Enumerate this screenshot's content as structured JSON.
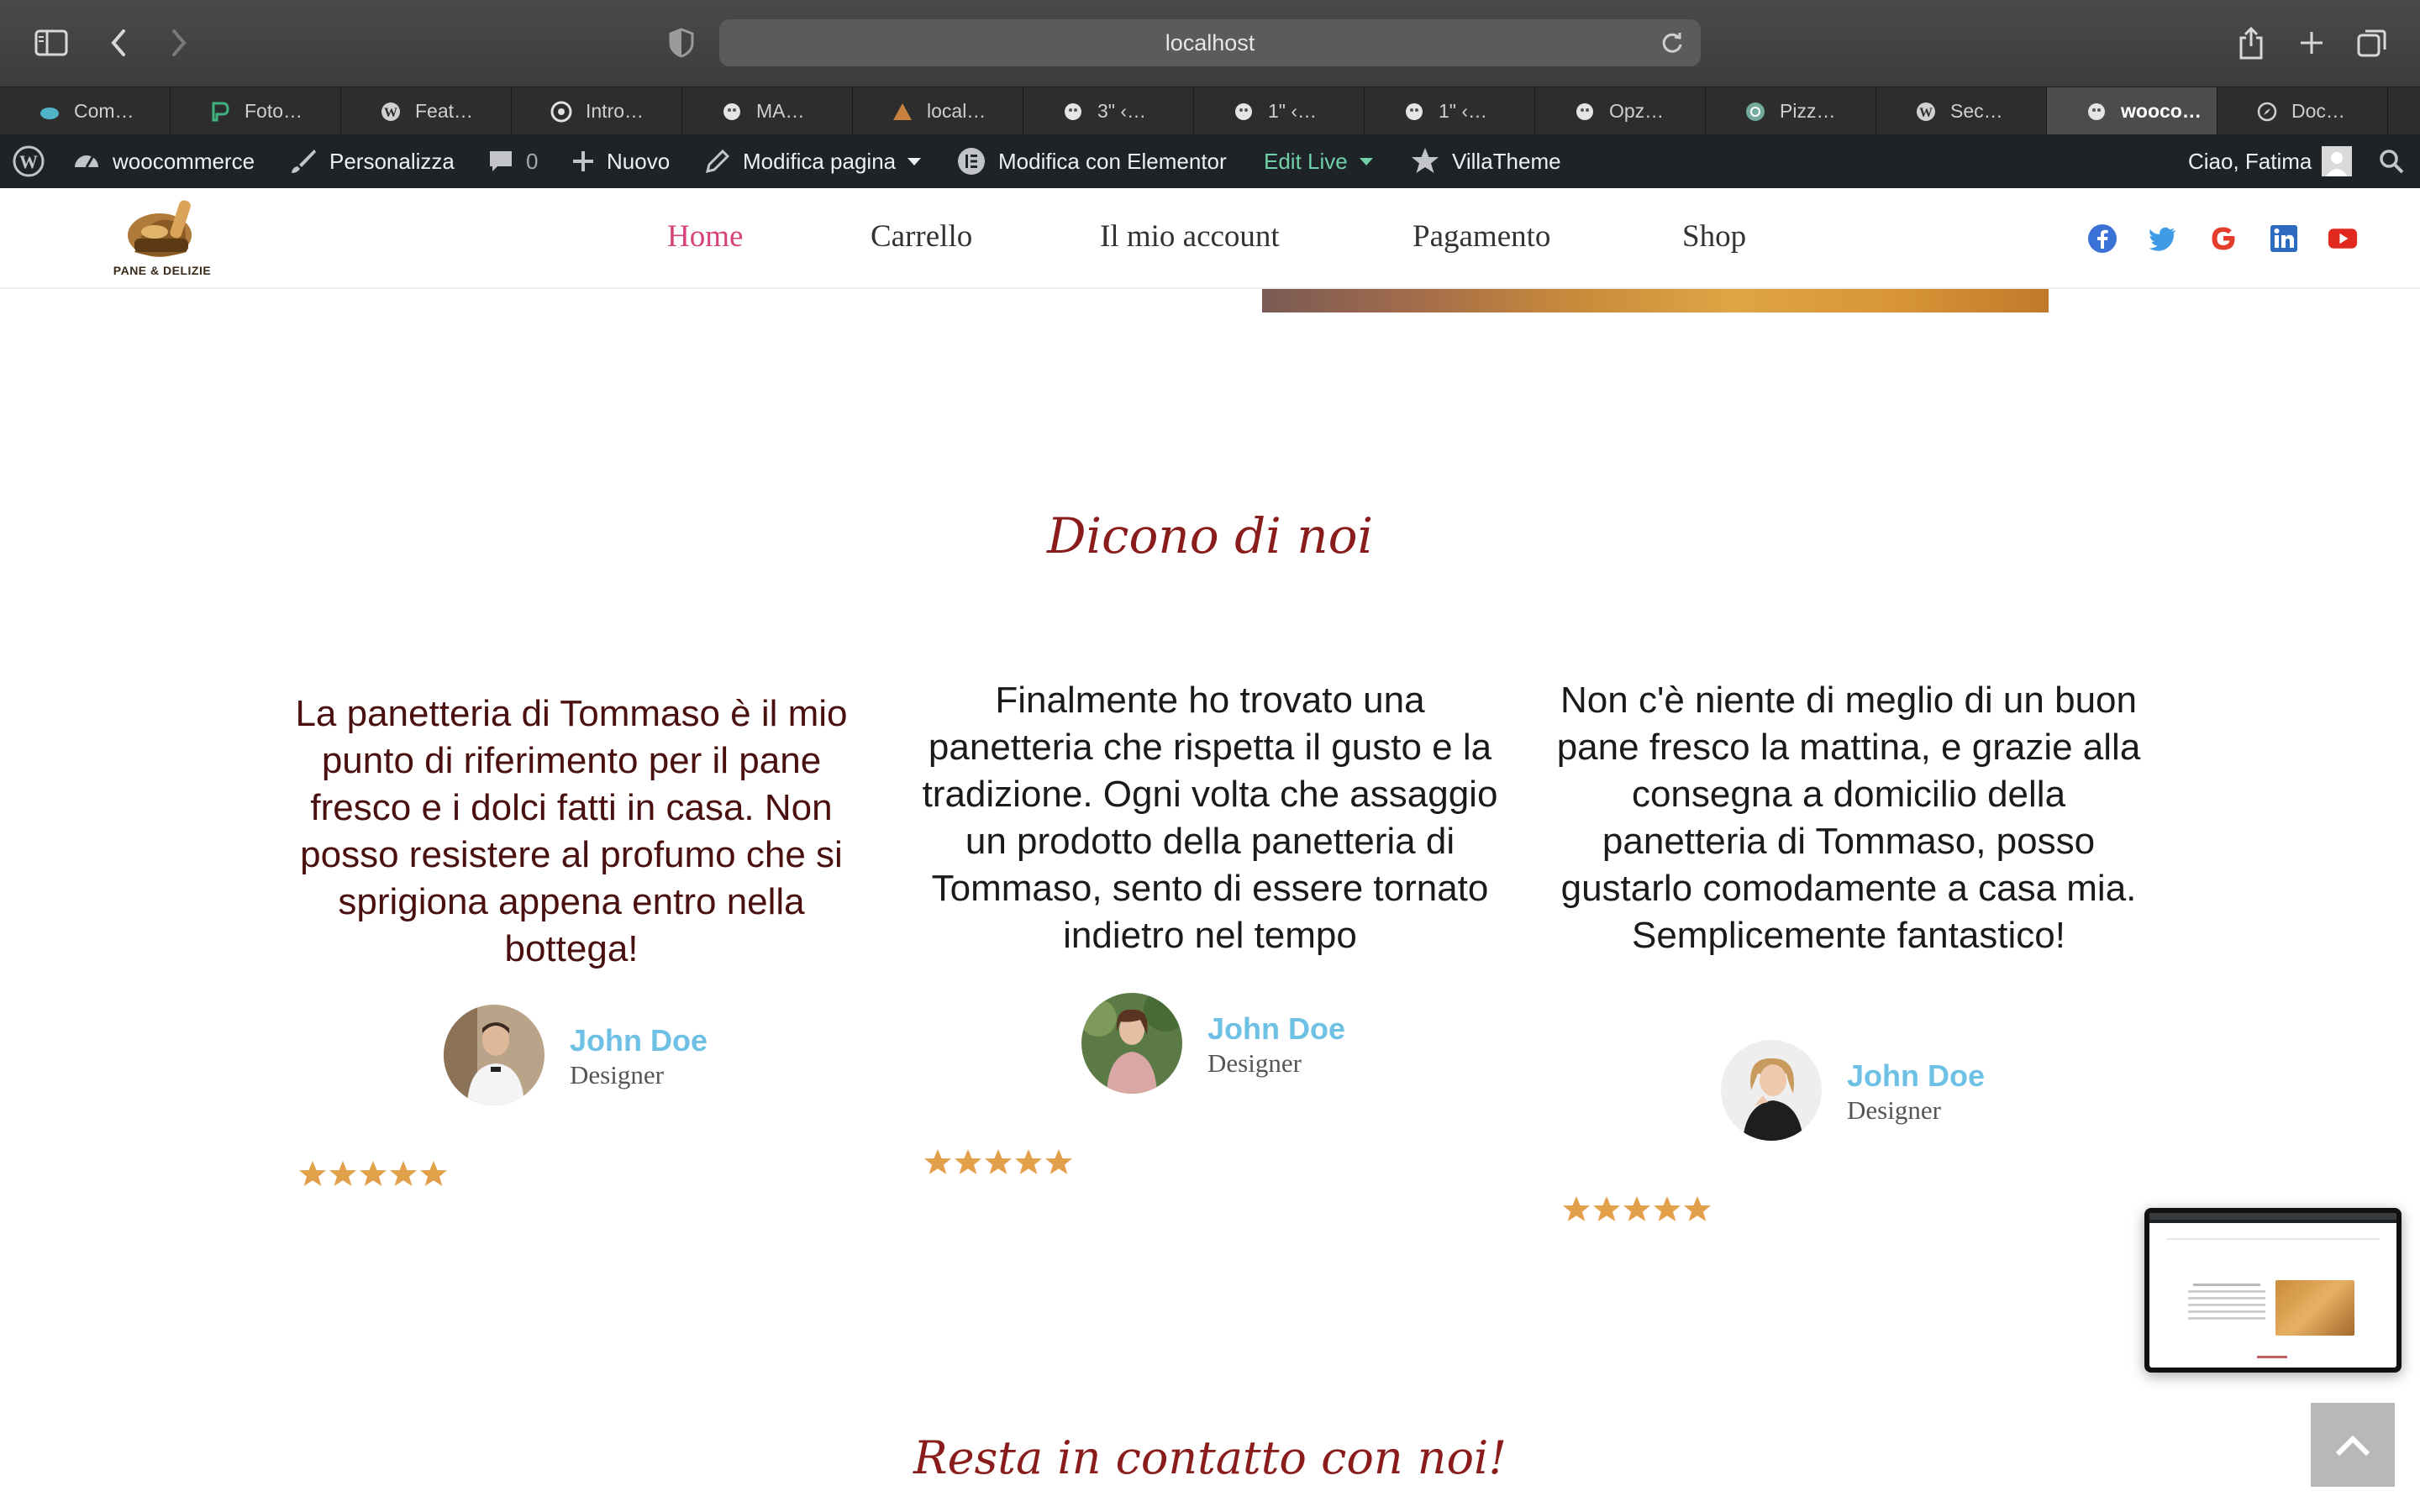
{
  "browser": {
    "url": "localhost",
    "tabs": [
      {
        "label": "Com…",
        "active": false
      },
      {
        "label": "Foto…",
        "active": false
      },
      {
        "label": "Feat…",
        "active": false
      },
      {
        "label": "Intro…",
        "active": false
      },
      {
        "label": "MA…",
        "active": false
      },
      {
        "label": "local…",
        "active": false
      },
      {
        "label": "3\" ‹…",
        "active": false
      },
      {
        "label": "1\" ‹…",
        "active": false
      },
      {
        "label": "1\" ‹…",
        "active": false
      },
      {
        "label": "Opz…",
        "active": false
      },
      {
        "label": "Pizz…",
        "active": false
      },
      {
        "label": "Sec…",
        "active": false
      },
      {
        "label": "wooco…",
        "active": true
      },
      {
        "label": "Doc…",
        "active": false
      }
    ]
  },
  "adminbar": {
    "site": "woocommerce",
    "customize": "Personalizza",
    "comments": "0",
    "new": "Nuovo",
    "edit_page": "Modifica pagina",
    "elementor": "Modifica con Elementor",
    "edit_live": "Edit Live",
    "villatheme": "VillaTheme",
    "greeting": "Ciao, Fatima"
  },
  "header": {
    "logo_text": "PANE & DELIZIE",
    "nav": [
      "Home",
      "Carrello",
      "Il mio account",
      "Pagamento",
      "Shop"
    ],
    "social": [
      "facebook-icon",
      "twitter-icon",
      "google-icon",
      "linkedin-icon",
      "youtube-icon"
    ]
  },
  "testimonials": {
    "title": "Dicono di noi",
    "items": [
      {
        "text": "La panetteria di Tommaso è il mio punto di riferimento per il pane fresco e i dolci fatti in casa. Non posso resistere al profumo che si sprigiona appena entro nella bottega!",
        "name": "John Doe",
        "role": "Designer",
        "rating": 5
      },
      {
        "text": "Finalmente ho trovato una panetteria che rispetta il gusto e la tradizione. Ogni volta che assaggio un prodotto della panetteria di Tommaso, sento di essere tornato indietro nel tempo",
        "name": "John Doe",
        "role": "Designer",
        "rating": 5
      },
      {
        "text": "Non c'è niente di meglio di un buon pane fresco la mattina, e grazie alla consegna a domicilio della panetteria di Tommaso, posso gustarlo comodamente a casa mia. Semplicemente fantastico!",
        "name": "John Doe",
        "role": "Designer",
        "rating": 5
      }
    ]
  },
  "contact": {
    "title": "Resta in contatto con noi!"
  },
  "colors": {
    "accent_pink": "#d6427b",
    "title_red": "#8a1c1c",
    "name_blue": "#6ec1e4",
    "star_gold": "#e2a04a",
    "quote1": "#4a0f0f",
    "quote_dark": "#1a1a1a"
  }
}
